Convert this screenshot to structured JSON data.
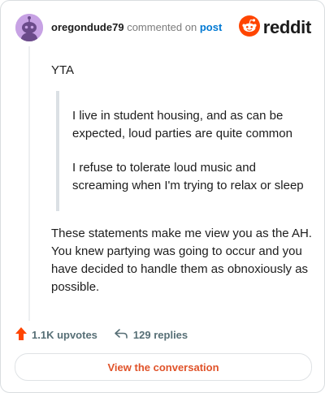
{
  "header": {
    "username": "oregondude79",
    "action_text": "commented on",
    "post_link": "post",
    "brand": "reddit"
  },
  "comment": {
    "top_line": "YTA",
    "quotes": [
      "I live in student housing, and as can be expected, loud parties are quite common",
      "I refuse to tolerate loud music and screaming when I'm trying to relax or sleep"
    ],
    "body": "These statements make me view you as the AH. You knew partying was going to occur and you have decided to handle them as obnoxiously as possible."
  },
  "stats": {
    "upvotes": "1.1K upvotes",
    "replies": "129 replies"
  },
  "cta": {
    "label": "View the conversation"
  },
  "colors": {
    "accent": "#ff4500",
    "link": "#0079d3",
    "cta_text": "#e0532a",
    "avatar_bg": "#c7a2e4"
  },
  "icons": [
    "snoo-avatar-icon",
    "reddit-logo-icon",
    "upvote-arrow-icon",
    "reply-arrow-icon"
  ]
}
